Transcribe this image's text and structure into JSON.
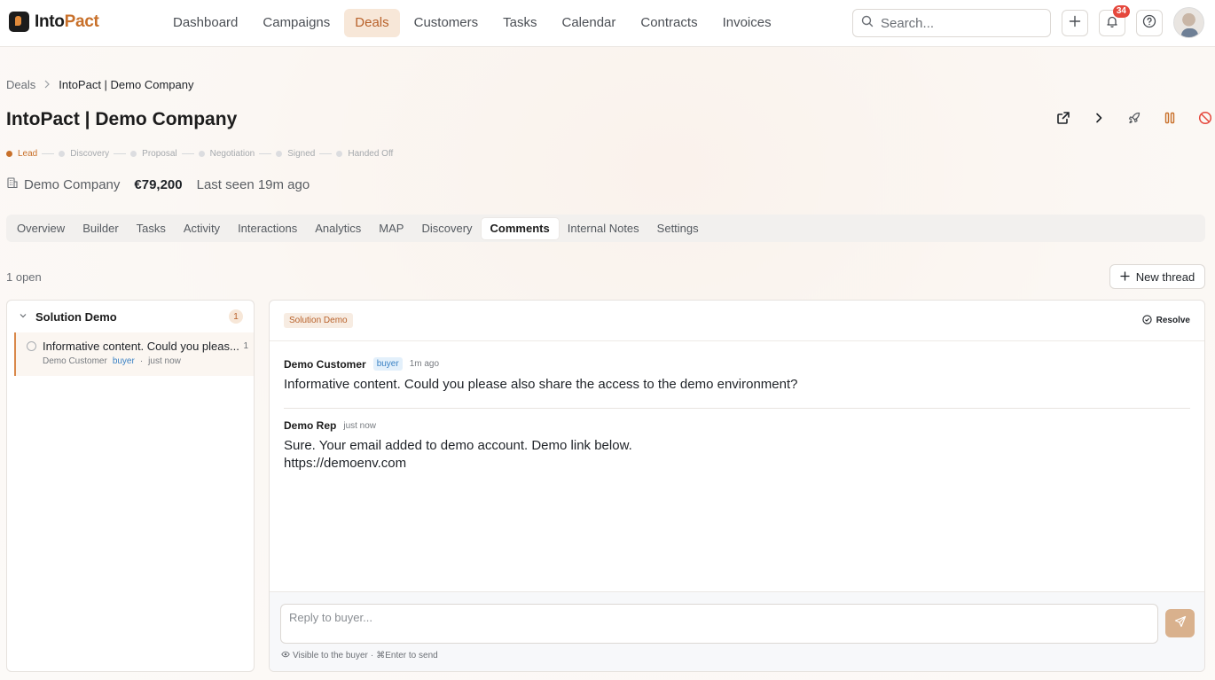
{
  "app": {
    "logo_left": "Into",
    "logo_right": "Pact"
  },
  "nav": {
    "items": [
      {
        "label": "Dashboard"
      },
      {
        "label": "Campaigns"
      },
      {
        "label": "Deals"
      },
      {
        "label": "Customers"
      },
      {
        "label": "Tasks"
      },
      {
        "label": "Calendar"
      },
      {
        "label": "Contracts"
      },
      {
        "label": "Invoices"
      }
    ],
    "active": "Deals"
  },
  "search": {
    "placeholder": "Search..."
  },
  "notifications": {
    "count": "34"
  },
  "breadcrumb": {
    "parent": "Deals",
    "current": "IntoPact | Demo Company"
  },
  "deal": {
    "title": "IntoPact | Demo Company",
    "company": "Demo Company",
    "amount": "€79,200",
    "last_seen": "Last seen 19m ago"
  },
  "stages": [
    {
      "label": "Lead"
    },
    {
      "label": "Discovery"
    },
    {
      "label": "Proposal"
    },
    {
      "label": "Negotiation"
    },
    {
      "label": "Signed"
    },
    {
      "label": "Handed Off"
    }
  ],
  "tabs": [
    {
      "label": "Overview"
    },
    {
      "label": "Builder"
    },
    {
      "label": "Tasks"
    },
    {
      "label": "Activity"
    },
    {
      "label": "Interactions"
    },
    {
      "label": "Analytics"
    },
    {
      "label": "MAP"
    },
    {
      "label": "Discovery"
    },
    {
      "label": "Comments"
    },
    {
      "label": "Internal Notes"
    },
    {
      "label": "Settings"
    }
  ],
  "comments": {
    "open_count": "1 open",
    "new_thread_label": "New thread",
    "group": {
      "title": "Solution Demo",
      "count": "1"
    },
    "thread": {
      "preview": "Informative content. Could you pleas...",
      "reply_count": "1",
      "author": "Demo Customer",
      "role": "buyer",
      "separator": "·",
      "time": "just now"
    },
    "detail": {
      "topic": "Solution Demo",
      "resolve_label": "Resolve",
      "messages": [
        {
          "author": "Demo Customer",
          "role": "buyer",
          "time": "1m ago",
          "line1": "Informative content. Could you please also share the access to the demo environment?",
          "line2": ""
        },
        {
          "author": "Demo Rep",
          "role": "",
          "time": "just now",
          "line1": "Sure. Your email added to demo account. Demo link below.",
          "line2": "https://demoenv.com"
        }
      ],
      "reply_placeholder": "Reply to buyer...",
      "hint_visibility": "Visible to the buyer",
      "hint_separator": "·",
      "hint_send": "⌘Enter to send"
    }
  },
  "colors": {
    "accent": "#c8702a",
    "accent_bg": "#f7e7d8",
    "buyer_blue": "#3b82c4",
    "danger": "#e5483d"
  }
}
